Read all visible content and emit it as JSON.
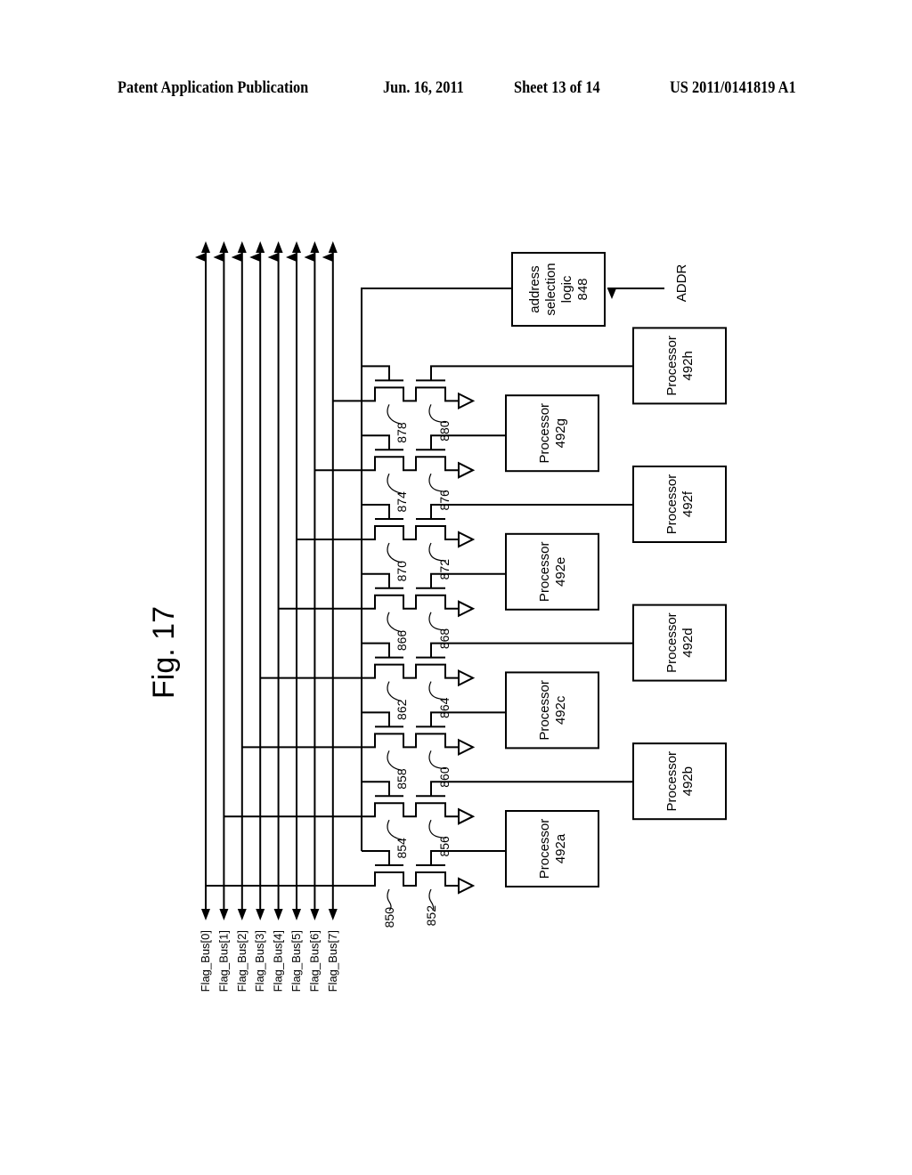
{
  "header": {
    "publication": "Patent Application Publication",
    "date": "Jun. 16, 2011",
    "sheet": "Sheet 13 of 14",
    "patent_number": "US 2011/0141819 A1"
  },
  "figure": {
    "title": "Fig. 17",
    "address_block": {
      "lines": [
        "address",
        "selection",
        "logic",
        "848"
      ],
      "input_label": "ADDR"
    },
    "flag_bus": [
      "Flag_Bus[0]",
      "Flag_Bus[1]",
      "Flag_Bus[2]",
      "Flag_Bus[3]",
      "Flag_Bus[4]",
      "Flag_Bus[5]",
      "Flag_Bus[6]",
      "Flag_Bus[7]"
    ],
    "transistor_pairs": [
      {
        "first": "850",
        "second": "852",
        "processor": "Processor 492a",
        "column": "left"
      },
      {
        "first": "854",
        "second": "856",
        "processor": "Processor 492b",
        "column": "right"
      },
      {
        "first": "858",
        "second": "860",
        "processor": "Processor 492c",
        "column": "left"
      },
      {
        "first": "862",
        "second": "864",
        "processor": "Processor 492d",
        "column": "right"
      },
      {
        "first": "866",
        "second": "868",
        "processor": "Processor 492e",
        "column": "left"
      },
      {
        "first": "870",
        "second": "872",
        "processor": "Processor 492f",
        "column": "right"
      },
      {
        "first": "874",
        "second": "876",
        "processor": "Processor 492g",
        "column": "left"
      },
      {
        "first": "878",
        "second": "880",
        "processor": "Processor 492h",
        "column": "right"
      }
    ],
    "processors": [
      {
        "name": "Processor",
        "id": "492a"
      },
      {
        "name": "Processor",
        "id": "492b"
      },
      {
        "name": "Processor",
        "id": "492c"
      },
      {
        "name": "Processor",
        "id": "492d"
      },
      {
        "name": "Processor",
        "id": "492e"
      },
      {
        "name": "Processor",
        "id": "492f"
      },
      {
        "name": "Processor",
        "id": "492g"
      },
      {
        "name": "Processor",
        "id": "492h"
      }
    ],
    "line_color": "#000000"
  }
}
